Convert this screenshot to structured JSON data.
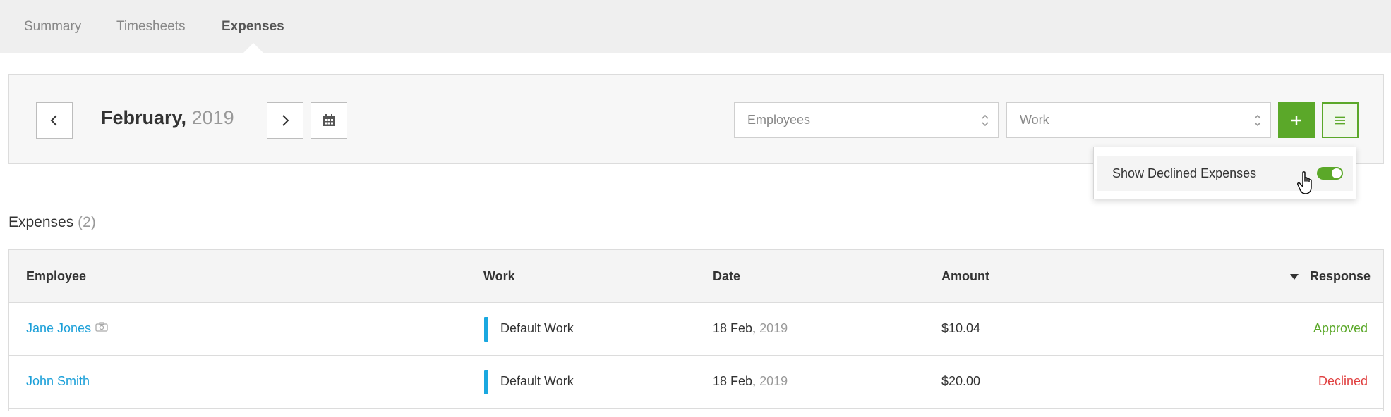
{
  "tabs": [
    {
      "label": "Summary"
    },
    {
      "label": "Timesheets"
    },
    {
      "label": "Expenses"
    }
  ],
  "toolbar": {
    "month": "February,",
    "year": "2019",
    "employees_placeholder": "Employees",
    "work_placeholder": "Work"
  },
  "popup": {
    "show_declined_label": "Show Declined Expenses",
    "show_declined_on": true
  },
  "section": {
    "title": "Expenses",
    "count": "(2)"
  },
  "table": {
    "columns": [
      "Employee",
      "Work",
      "Date",
      "Amount",
      "Response"
    ],
    "rows": [
      {
        "employee": "Jane Jones",
        "has_receipt": true,
        "work": "Default Work",
        "date": "18 Feb,",
        "year": "2019",
        "amount": "$10.04",
        "response": "Approved"
      },
      {
        "employee": "John Smith",
        "has_receipt": false,
        "work": "Default Work",
        "date": "18 Feb,",
        "year": "2019",
        "amount": "$20.00",
        "response": "Declined"
      }
    ]
  },
  "colors": {
    "accent_green": "#5ba829",
    "link_blue": "#1a9fd8",
    "work_bar": "#1aa8e0",
    "declined_red": "#e04040"
  }
}
